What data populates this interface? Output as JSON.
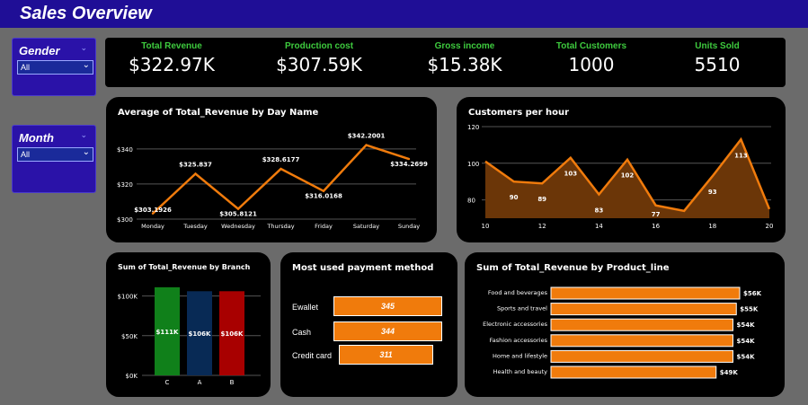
{
  "header": {
    "title": "Sales Overview"
  },
  "slicers": {
    "gender": {
      "label": "Gender",
      "value": "All"
    },
    "month": {
      "label": "Month",
      "value": "All"
    }
  },
  "kpis": [
    {
      "label": "Total Revenue",
      "value": "$322.97K"
    },
    {
      "label": "Production cost",
      "value": "$307.59K"
    },
    {
      "label": "Gross income",
      "value": "$15.38K"
    },
    {
      "label": "Total Customers",
      "value": "1000"
    },
    {
      "label": "Units Sold",
      "value": "5510"
    }
  ],
  "colors": {
    "accent": "#f07b0c",
    "kpi_label": "#3ecb3e",
    "header": "#1f0e96"
  },
  "chart_data": [
    {
      "id": "day",
      "type": "line",
      "title": "Average of Total_Revenue by Day Name",
      "categories": [
        "Monday",
        "Tuesday",
        "Wednesday",
        "Thursday",
        "Friday",
        "Saturday",
        "Sunday"
      ],
      "values": [
        303.1926,
        325.837,
        305.8121,
        328.6177,
        316.0168,
        342.2001,
        334.2699
      ],
      "labels": [
        "$303.1926",
        "$325.837",
        "$305.8121",
        "$328.6177",
        "$316.0168",
        "$342.2001",
        "$334.2699"
      ],
      "yticks": [
        "$300",
        "$320",
        "$340"
      ],
      "ylim": [
        300,
        344
      ]
    },
    {
      "id": "hour",
      "type": "area",
      "title": "Customers per hour",
      "x": [
        10,
        11,
        12,
        13,
        14,
        15,
        16,
        17,
        18,
        19,
        20
      ],
      "values": [
        101,
        90,
        89,
        103,
        83,
        102,
        77,
        74,
        93,
        113,
        75
      ],
      "labels": [
        "",
        "90",
        "89",
        "103",
        "83",
        "102",
        "77",
        "",
        "93",
        "113",
        ""
      ],
      "xticks": [
        "10",
        "12",
        "14",
        "16",
        "18",
        "20"
      ],
      "yticks": [
        "80",
        "100",
        "120"
      ],
      "ylim": [
        70,
        120
      ]
    },
    {
      "id": "branch",
      "type": "bar",
      "title": "Sum of Total_Revenue by Branch",
      "categories": [
        "C",
        "A",
        "B"
      ],
      "values": [
        111,
        106,
        106
      ],
      "labels": [
        "$111K",
        "$106K",
        "$106K"
      ],
      "colors": [
        "#10801a",
        "#082a55",
        "#a80000"
      ],
      "yticks": [
        "$0K",
        "$50K",
        "$100K"
      ],
      "ylim": [
        0,
        112
      ]
    },
    {
      "id": "payment",
      "type": "bar",
      "title": "Most used payment method",
      "categories": [
        "Ewallet",
        "Cash",
        "Credit card"
      ],
      "values": [
        345,
        344,
        311
      ],
      "labels": [
        "345",
        "344",
        "311"
      ]
    },
    {
      "id": "product",
      "type": "bar",
      "title": "Sum of Total_Revenue by Product_line",
      "categories": [
        "Food and beverages",
        "Sports and travel",
        "Electronic accessories",
        "Fashion accessories",
        "Home and lifestyle",
        "Health and beauty"
      ],
      "values": [
        56,
        55,
        54,
        54,
        54,
        49
      ],
      "labels": [
        "$56K",
        "$55K",
        "$54K",
        "$54K",
        "$54K",
        "$49K"
      ]
    }
  ]
}
